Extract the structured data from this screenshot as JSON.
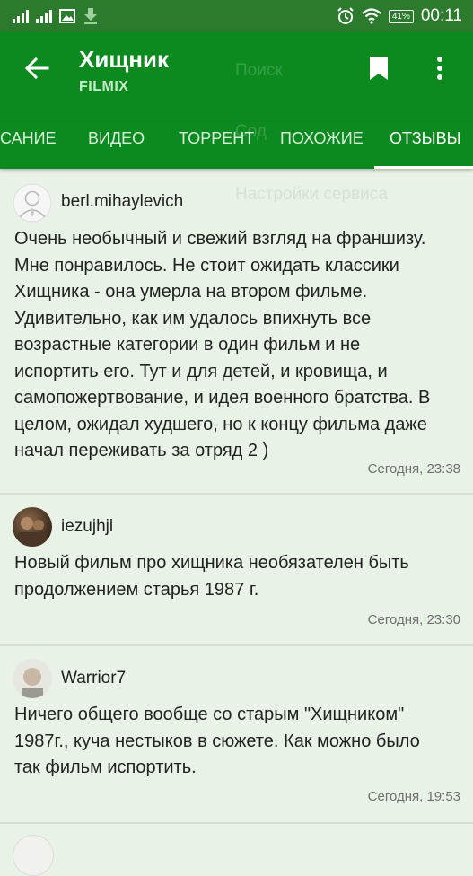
{
  "status_bar": {
    "network": "ᴴ",
    "battery": "41%",
    "time": "00:11"
  },
  "app_bar": {
    "title": "Хищник",
    "subtitle": "FILMIX"
  },
  "tabs": [
    {
      "label": "САНИЕ",
      "active": false
    },
    {
      "label": "ВИДЕО",
      "active": false
    },
    {
      "label": "ТОРРЕНТ",
      "active": false
    },
    {
      "label": "ПОХОЖИЕ",
      "active": false
    },
    {
      "label": "ОТЗЫВЫ",
      "active": true
    }
  ],
  "ghost_menu": [
    "Поиск",
    "Сод",
    "Настройки сервиса"
  ],
  "reviews": [
    {
      "author": "berl.mihaylevich",
      "avatar": "default-user-avatar",
      "text": "Очень необычный и свежий взгляд на франшизу. Мне понравилось. Не стоит ожидать классики Хищника - она умерла на втором фильме. Удивительно, как им удалось впихнуть все возрастные категории в один фильм и не испортить его. Тут и для детей, и кровища, и самопожертвование, и идея военного братства. В целом, ожидал худшего, но к концу фильма даже начал переживать за отряд 2 )",
      "date": "Сегодня, 23:38"
    },
    {
      "author": "iezujhjl",
      "avatar": "photo-avatar",
      "text": "Новый фильм про хищника необязателен быть продолжением старья 1987 г.",
      "date": "Сегодня, 23:30"
    },
    {
      "author": "Warrior7",
      "avatar": "photo-avatar",
      "text": "Ничего общего вообще со старым \"Хищником\" 1987г., куча нестыков в сюжете. Как можно было так фильм испортить.",
      "date": "Сегодня, 19:53"
    }
  ]
}
